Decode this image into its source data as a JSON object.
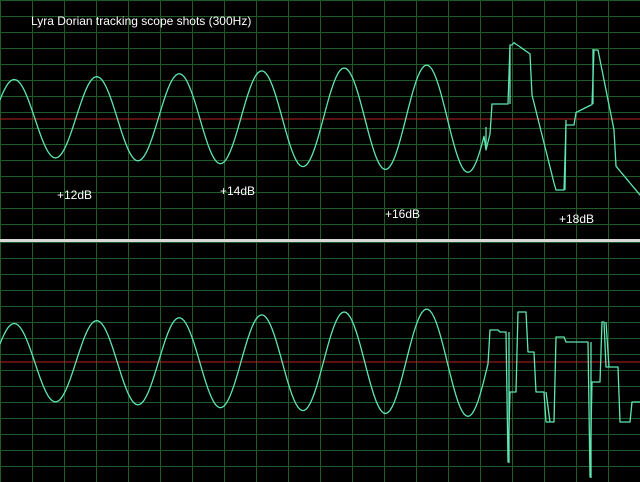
{
  "window": {
    "title": "Lyra Dorian tracking scope shots (300Hz)"
  },
  "labels": [
    "+12dB",
    "+14dB",
    "+16dB",
    "+18dB"
  ],
  "colors": {
    "background": "#000000",
    "grid": "#1f5b26",
    "trace": "#5fe5b0",
    "reference": "#b32222",
    "text": "#ffffff",
    "divider": "#d7d7d7"
  }
}
